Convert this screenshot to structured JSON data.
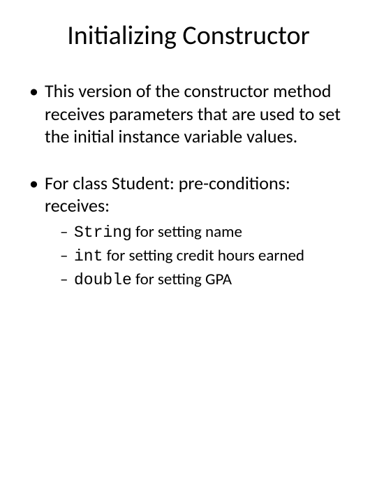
{
  "title": "Initializing Constructor",
  "bullets": [
    {
      "text": "This version of the constructor method receives parameters that are used to set the initial instance variable values."
    },
    {
      "text": "For class Student: pre-conditions: receives:",
      "sub": [
        {
          "code": "String",
          "rest": " for setting name"
        },
        {
          "code": "int",
          "rest": " for setting credit hours earned"
        },
        {
          "code": "double",
          "rest": " for setting GPA"
        }
      ]
    }
  ]
}
